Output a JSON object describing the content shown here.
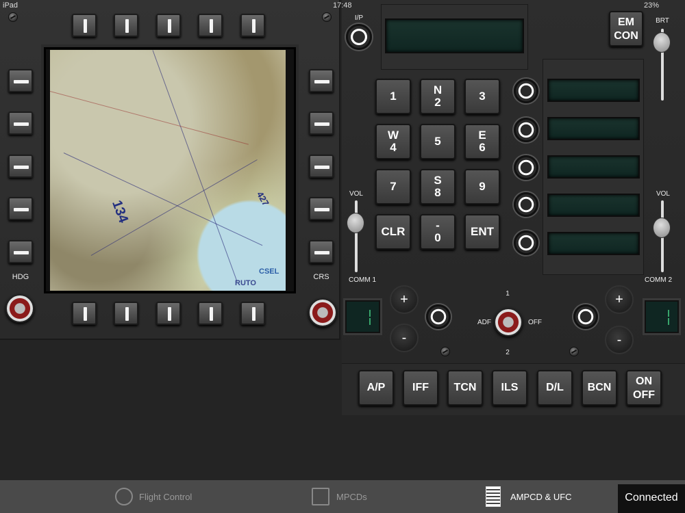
{
  "status_bar": {
    "device": "iPad",
    "time": "17:48",
    "battery": "23%"
  },
  "mpcd": {
    "left_label": "HDG",
    "right_label": "CRS",
    "map_labels": [
      "134",
      "427",
      "CSEL",
      "RUTO"
    ]
  },
  "ufc": {
    "ip_label": "I/P",
    "em_con": [
      "EM",
      "CON"
    ],
    "brt_label": "BRT",
    "vol_left": "VOL",
    "vol_right": "VOL",
    "keys": [
      {
        "top": "",
        "main": "1"
      },
      {
        "top": "N",
        "main": "2"
      },
      {
        "top": "",
        "main": "3"
      },
      {
        "top": "W",
        "main": "4"
      },
      {
        "top": "",
        "main": "5"
      },
      {
        "top": "E",
        "main": "6"
      },
      {
        "top": "",
        "main": "7"
      },
      {
        "top": "S",
        "main": "8"
      },
      {
        "top": "",
        "main": "9"
      },
      {
        "top": "",
        "main": "CLR"
      },
      {
        "top": "-",
        "main": "0"
      },
      {
        "top": "",
        "main": "ENT"
      }
    ],
    "comm1": "COMM 1",
    "comm2": "COMM 2",
    "plus": "+",
    "minus": "-",
    "adf": "ADF",
    "off": "OFF",
    "pos1": "1",
    "pos2": "2",
    "modes": [
      "A/P",
      "IFF",
      "TCN",
      "ILS",
      "D/L",
      "BCN"
    ],
    "onoff": [
      "ON",
      "OFF"
    ]
  },
  "tabs": [
    {
      "label": "Flight Control",
      "icon": "flight-control-icon",
      "active": false
    },
    {
      "label": "MPCDs",
      "icon": "mpcds-icon",
      "active": false
    },
    {
      "label": "AMPCD & UFC",
      "icon": "keypad-icon",
      "active": true
    }
  ],
  "connection": "Connected"
}
